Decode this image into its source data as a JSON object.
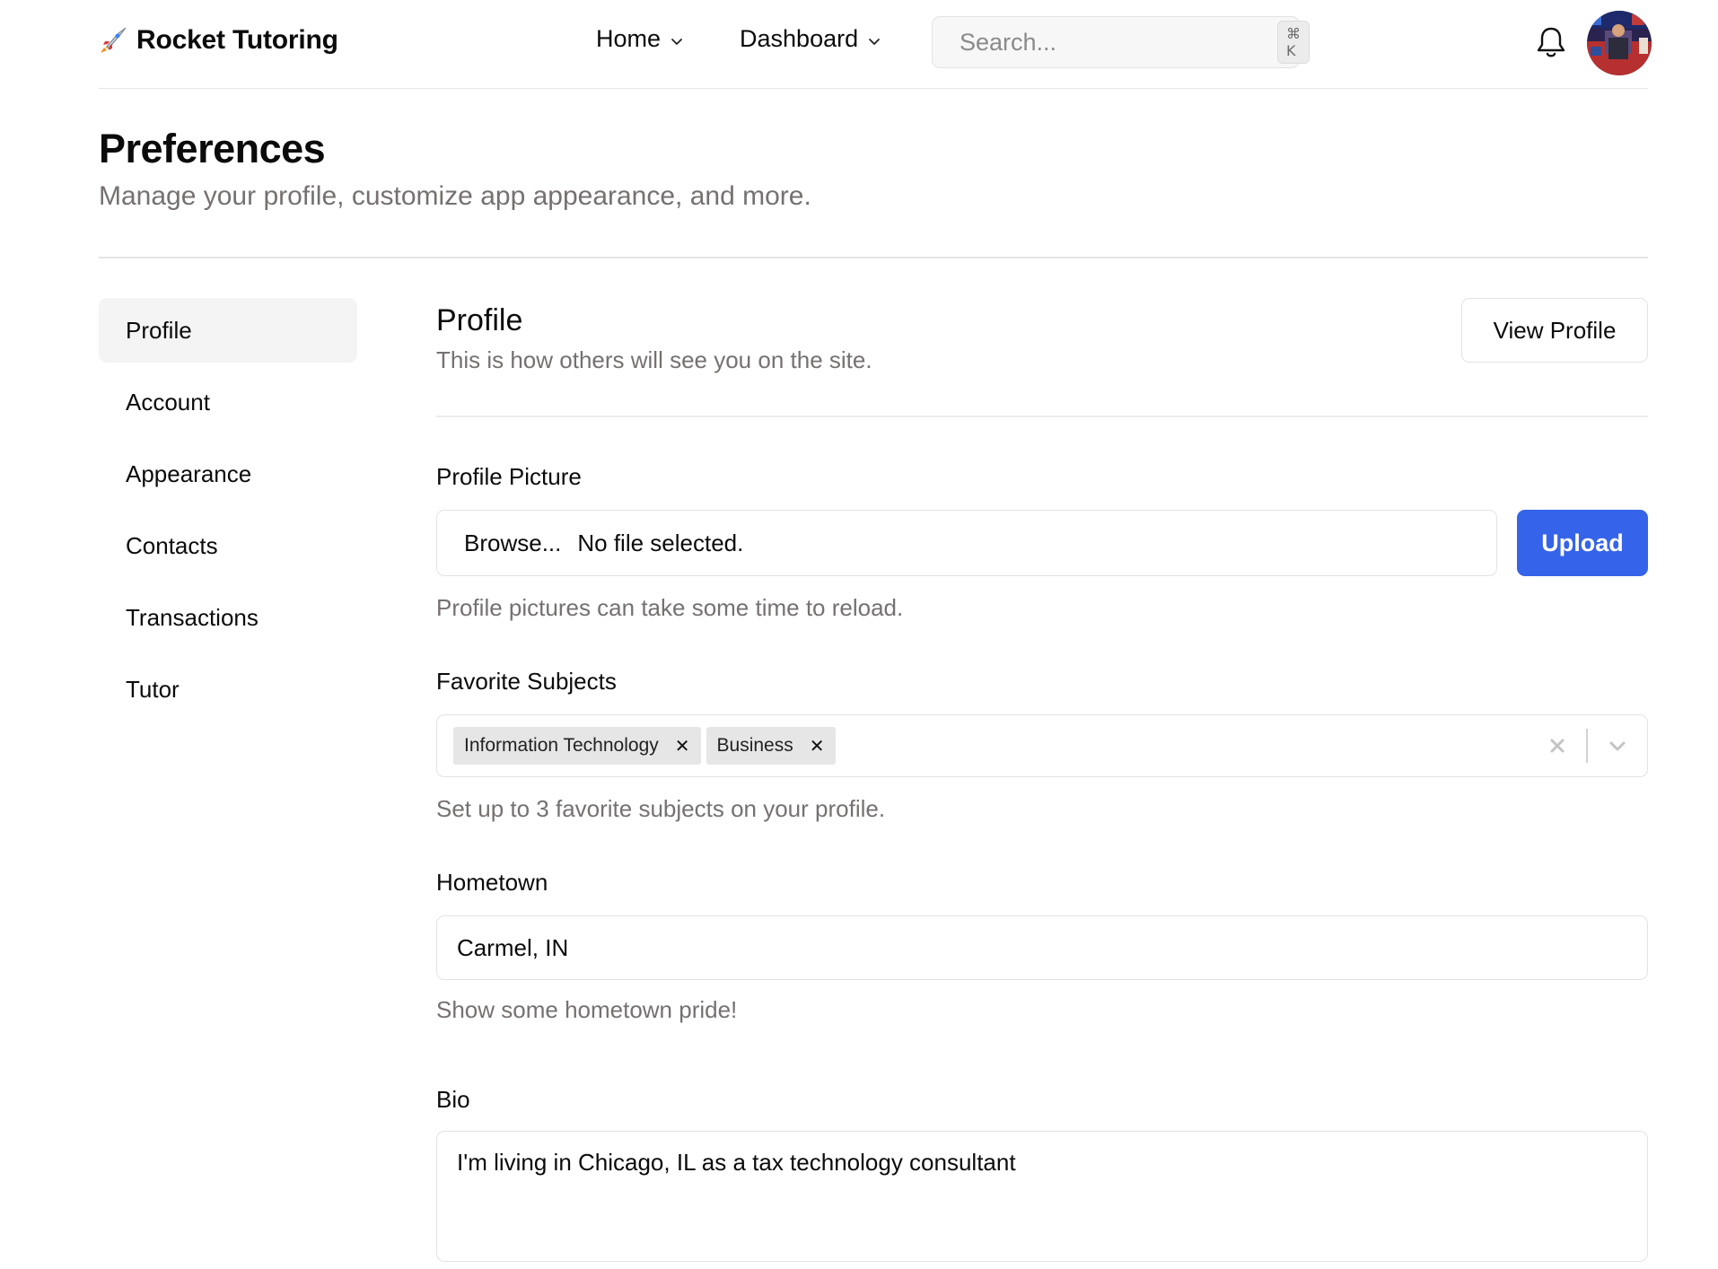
{
  "app": {
    "name": "Rocket Tutoring",
    "logo_icon": "rocket-icon"
  },
  "header": {
    "nav": [
      {
        "label": "Home",
        "icon": "chevron-down-icon"
      },
      {
        "label": "Dashboard",
        "icon": "chevron-down-icon"
      }
    ],
    "search": {
      "placeholder": "Search...",
      "shortcut": "⌘ K"
    },
    "notification_icon": "bell-icon",
    "avatar_icon": "user-avatar"
  },
  "page": {
    "title": "Preferences",
    "subtitle": "Manage your profile, customize app appearance, and more."
  },
  "sidebar": {
    "items": [
      {
        "label": "Profile",
        "active": true
      },
      {
        "label": "Account",
        "active": false
      },
      {
        "label": "Appearance",
        "active": false
      },
      {
        "label": "Contacts",
        "active": false
      },
      {
        "label": "Transactions",
        "active": false
      },
      {
        "label": "Tutor",
        "active": false
      }
    ]
  },
  "profile": {
    "title": "Profile",
    "description": "This is how others will see you on the site.",
    "view_profile_label": "View Profile",
    "picture": {
      "label": "Profile Picture",
      "browse_label": "Browse...",
      "file_status": "No file selected.",
      "upload_label": "Upload",
      "help": "Profile pictures can take some time to reload."
    },
    "subjects": {
      "label": "Favorite Subjects",
      "selected": [
        "Information Technology",
        "Business"
      ],
      "help": "Set up to 3 favorite subjects on your profile."
    },
    "hometown": {
      "label": "Hometown",
      "value": "Carmel, IN",
      "help": "Show some hometown pride!"
    },
    "bio": {
      "label": "Bio",
      "value": "I'm living in Chicago, IL as a tax technology consultant"
    }
  },
  "colors": {
    "accent": "#3563e9",
    "muted_text": "#757170",
    "border": "#e3e3e3",
    "active_bg": "#f4f4f4"
  }
}
